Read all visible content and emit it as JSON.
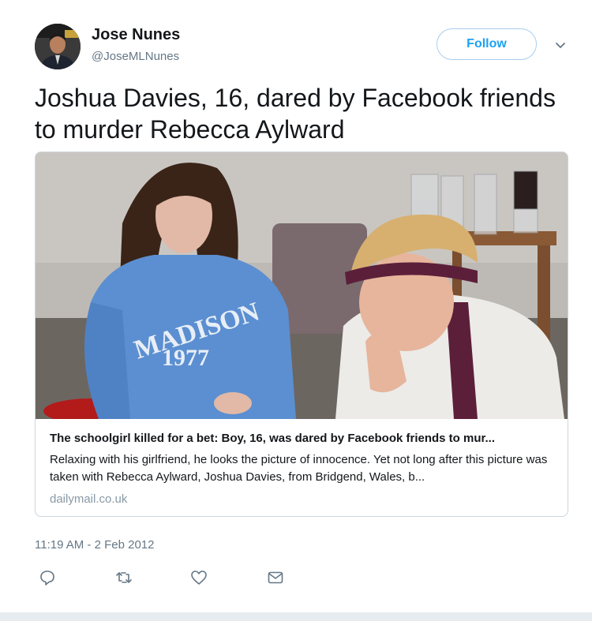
{
  "author": {
    "name": "Jose Nunes",
    "handle": "@JoseMLNunes",
    "avatar_icon": "profile-photo"
  },
  "follow_button": {
    "label": "Follow"
  },
  "tweet": {
    "text": "Joshua Davies, 16, dared by Facebook friends to murder Rebecca Aylward",
    "timestamp": "11:19 AM - 2 Feb 2012"
  },
  "card": {
    "title": "The schoolgirl killed for a bet: Boy, 16, was dared by Facebook friends to mur...",
    "description": "Relaxing with his girlfriend, he looks the picture of innocence. Yet not long after this picture was taken with Rebecca Aylward, Joshua Davies, from Bridgend, Wales, b...",
    "domain": "dailymail.co.uk",
    "image": {
      "sweatshirt_text": "MADISON",
      "sweatshirt_number": "1977"
    }
  },
  "actions": [
    "reply-icon",
    "retweet-icon",
    "like-icon",
    "direct-message-icon"
  ],
  "colors": {
    "accent": "#1da1f2",
    "text": "#14171a",
    "secondary": "#657786",
    "border": "#ccd6dd"
  }
}
